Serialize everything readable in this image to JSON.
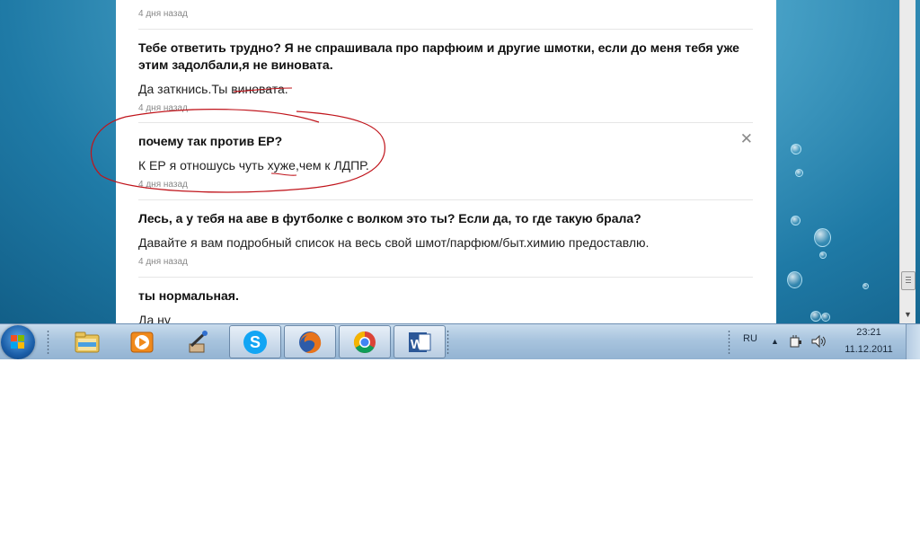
{
  "feed": {
    "top_timestamp": "4 дня назад",
    "items": [
      {
        "question": "Тебе ответить трудно? Я не спрашивала про парфюим и другие шмотки, если до меня тебя уже этим задолбали,я не виновата.",
        "answer": "Да заткнись.Ты виновата.",
        "time": "4 дня назад"
      },
      {
        "question": "почему так против ЕР?",
        "answer": "К ЕР я отношусь чуть хуже,чем к ЛДПР.",
        "time": "4 дня назад",
        "close_symbol": "✕"
      },
      {
        "question": "Лесь, а у тебя на аве в футболке с волком это ты? Если да, то где такую брала?",
        "answer": "Давайте я вам подробный список на весь свой шмот/парфюм/быт.химию предоставлю.",
        "time": "4 дня назад"
      },
      {
        "question": "ты нормальная.",
        "answer": "Да ну"
      }
    ],
    "annotation_color": "#c0141b"
  },
  "taskbar": {
    "apps": [
      {
        "name": "windows-explorer",
        "icon": "folder-icon"
      },
      {
        "name": "media-player",
        "icon": "media-player-icon"
      },
      {
        "name": "program",
        "icon": "wand-icon"
      },
      {
        "name": "skype",
        "icon": "skype-icon"
      },
      {
        "name": "firefox",
        "icon": "firefox-icon"
      },
      {
        "name": "chrome",
        "icon": "chrome-icon"
      },
      {
        "name": "word",
        "icon": "word-icon"
      }
    ],
    "tray": {
      "language": "RU",
      "time": "23:21",
      "date": "11.12.2011"
    }
  }
}
